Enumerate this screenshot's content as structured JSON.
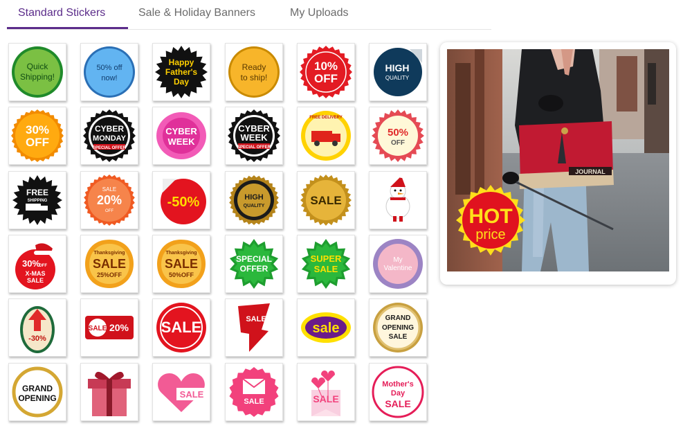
{
  "tabs": [
    {
      "label": "Standard Stickers",
      "active": true
    },
    {
      "label": "Sale & Holiday Banners",
      "active": false
    },
    {
      "label": "My Uploads",
      "active": false
    }
  ],
  "colors": {
    "accent": "#5b2c8a"
  },
  "stickers": [
    {
      "name": "quick-shipping",
      "lines": [
        "Quick",
        "Shipping!"
      ]
    },
    {
      "name": "50-off-now",
      "lines": [
        "50% off",
        "now!"
      ]
    },
    {
      "name": "happy-fathers-day",
      "lines": [
        "Happy",
        "Father's",
        "Day"
      ]
    },
    {
      "name": "ready-to-ship",
      "lines": [
        "Ready",
        "to ship!"
      ]
    },
    {
      "name": "10-off",
      "lines": [
        "10%",
        "OFF"
      ]
    },
    {
      "name": "high-quality",
      "lines": [
        "HIGH",
        "QUALITY"
      ]
    },
    {
      "name": "30-off",
      "lines": [
        "30%",
        "OFF"
      ]
    },
    {
      "name": "cyber-monday",
      "lines": [
        "CYBER",
        "MONDAY",
        "SPECIAL OFFER"
      ]
    },
    {
      "name": "cyber-week-pink",
      "lines": [
        "CYBER",
        "WEEK"
      ]
    },
    {
      "name": "cyber-week-black",
      "lines": [
        "CYBER",
        "WEEK",
        "SPECIAL OFFER"
      ]
    },
    {
      "name": "free-delivery",
      "lines": [
        "FREE DELIVERY"
      ]
    },
    {
      "name": "50-off-badge",
      "lines": [
        "50%",
        "OFF"
      ]
    },
    {
      "name": "free-shipping",
      "lines": [
        "FREE",
        "SHIPPING"
      ]
    },
    {
      "name": "sale-20-off",
      "lines": [
        "SALE",
        "20%",
        "OFF"
      ]
    },
    {
      "name": "minus-50-percent",
      "lines": [
        "-50%"
      ]
    },
    {
      "name": "high-quality-seal",
      "lines": [
        "HIGH",
        "QUALITY"
      ]
    },
    {
      "name": "sale-gold-seal",
      "lines": [
        "SALE"
      ]
    },
    {
      "name": "snowman",
      "lines": []
    },
    {
      "name": "xmas-sale",
      "lines": [
        "30%",
        "OFF",
        "X-MAS",
        "SALE"
      ]
    },
    {
      "name": "thanksgiving-sale-25",
      "lines": [
        "Thanksgiving",
        "SALE",
        "25%OFF"
      ]
    },
    {
      "name": "thanksgiving-sale-50",
      "lines": [
        "Thanksgiving",
        "SALE",
        "50%OFF"
      ]
    },
    {
      "name": "special-offer",
      "lines": [
        "SPECIAL",
        "OFFER"
      ]
    },
    {
      "name": "super-sale",
      "lines": [
        "SUPER",
        "SALE"
      ]
    },
    {
      "name": "my-valentine",
      "lines": [
        "My",
        "Valentine"
      ]
    },
    {
      "name": "egg-minus-30",
      "lines": [
        "-30%"
      ]
    },
    {
      "name": "sale-20-banner",
      "lines": [
        "SALE",
        "20%"
      ]
    },
    {
      "name": "sale-red-circle",
      "lines": [
        "SALE"
      ]
    },
    {
      "name": "sale-arrow",
      "lines": [
        "SALE"
      ]
    },
    {
      "name": "sale-purple",
      "lines": [
        "sale"
      ]
    },
    {
      "name": "grand-opening-sale",
      "lines": [
        "GRAND",
        "OPENING",
        "SALE"
      ]
    },
    {
      "name": "grand-opening",
      "lines": [
        "GRAND",
        "OPENING"
      ]
    },
    {
      "name": "gift-box",
      "lines": []
    },
    {
      "name": "sale-heart",
      "lines": [
        "SALE"
      ]
    },
    {
      "name": "sale-envelope",
      "lines": [
        "SALE"
      ]
    },
    {
      "name": "sale-balloons",
      "lines": [
        "SALE"
      ]
    },
    {
      "name": "mothers-day-sale",
      "lines": [
        "Mother's",
        "Day",
        "SALE"
      ]
    }
  ],
  "preview": {
    "sticker_lines": [
      "HOT",
      "price"
    ],
    "bag_label": "JOURNAL"
  }
}
